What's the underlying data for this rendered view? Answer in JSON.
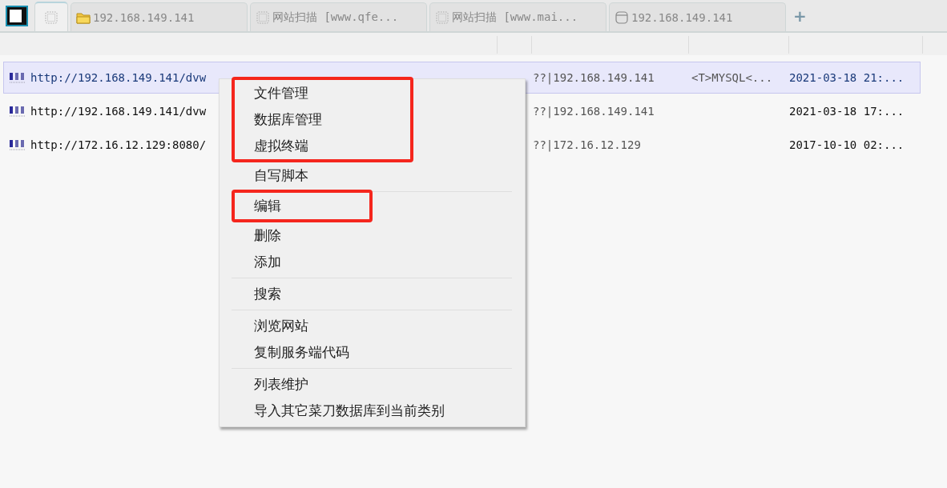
{
  "tabs": [
    {
      "kind": "dotted",
      "selected": true
    },
    {
      "kind": "folder",
      "label": "192.168.149.141",
      "selected": false
    },
    {
      "kind": "dotted",
      "label": "网站扫描 [www.qfe...",
      "selected": false
    },
    {
      "kind": "dotted",
      "label": "网站扫描 [www.mai...",
      "selected": false
    },
    {
      "kind": "database",
      "label": "192.168.149.141",
      "selected": false
    }
  ],
  "add_tab": "+",
  "table": {
    "rows": [
      {
        "url": "http://192.168.149.141/dvw",
        "ip": "??|192.168.149.141",
        "note": "<T>MYSQL<...",
        "time": "2021-03-18 21:...",
        "selected": true
      },
      {
        "url": "http://192.168.149.141/dvw",
        "ip": "??|192.168.149.141",
        "time": "2021-03-18 17:...",
        "selected": false
      },
      {
        "url": "http://172.16.12.129:8080/",
        "ip": "??|172.16.12.129",
        "time": "2017-10-10 02:...",
        "selected": false
      }
    ]
  },
  "context_menu": {
    "groups": [
      [
        {
          "label": "文件管理",
          "marked": true
        },
        {
          "label": "数据库管理",
          "marked": true
        },
        {
          "label": "虚拟终端",
          "marked": true
        },
        {
          "label": "自写脚本",
          "marked": false
        }
      ],
      [
        {
          "label": "编辑",
          "marked": true
        },
        {
          "label": "删除",
          "marked": false
        },
        {
          "label": "添加",
          "marked": false
        }
      ],
      [
        {
          "label": "搜索",
          "marked": false
        }
      ],
      [
        {
          "label": "浏览网站",
          "marked": false
        },
        {
          "label": "复制服务端代码",
          "marked": false
        }
      ],
      [
        {
          "label": "列表维护",
          "marked": false
        },
        {
          "label": "导入其它菜刀数据库到当前类别",
          "marked": false
        }
      ]
    ]
  }
}
